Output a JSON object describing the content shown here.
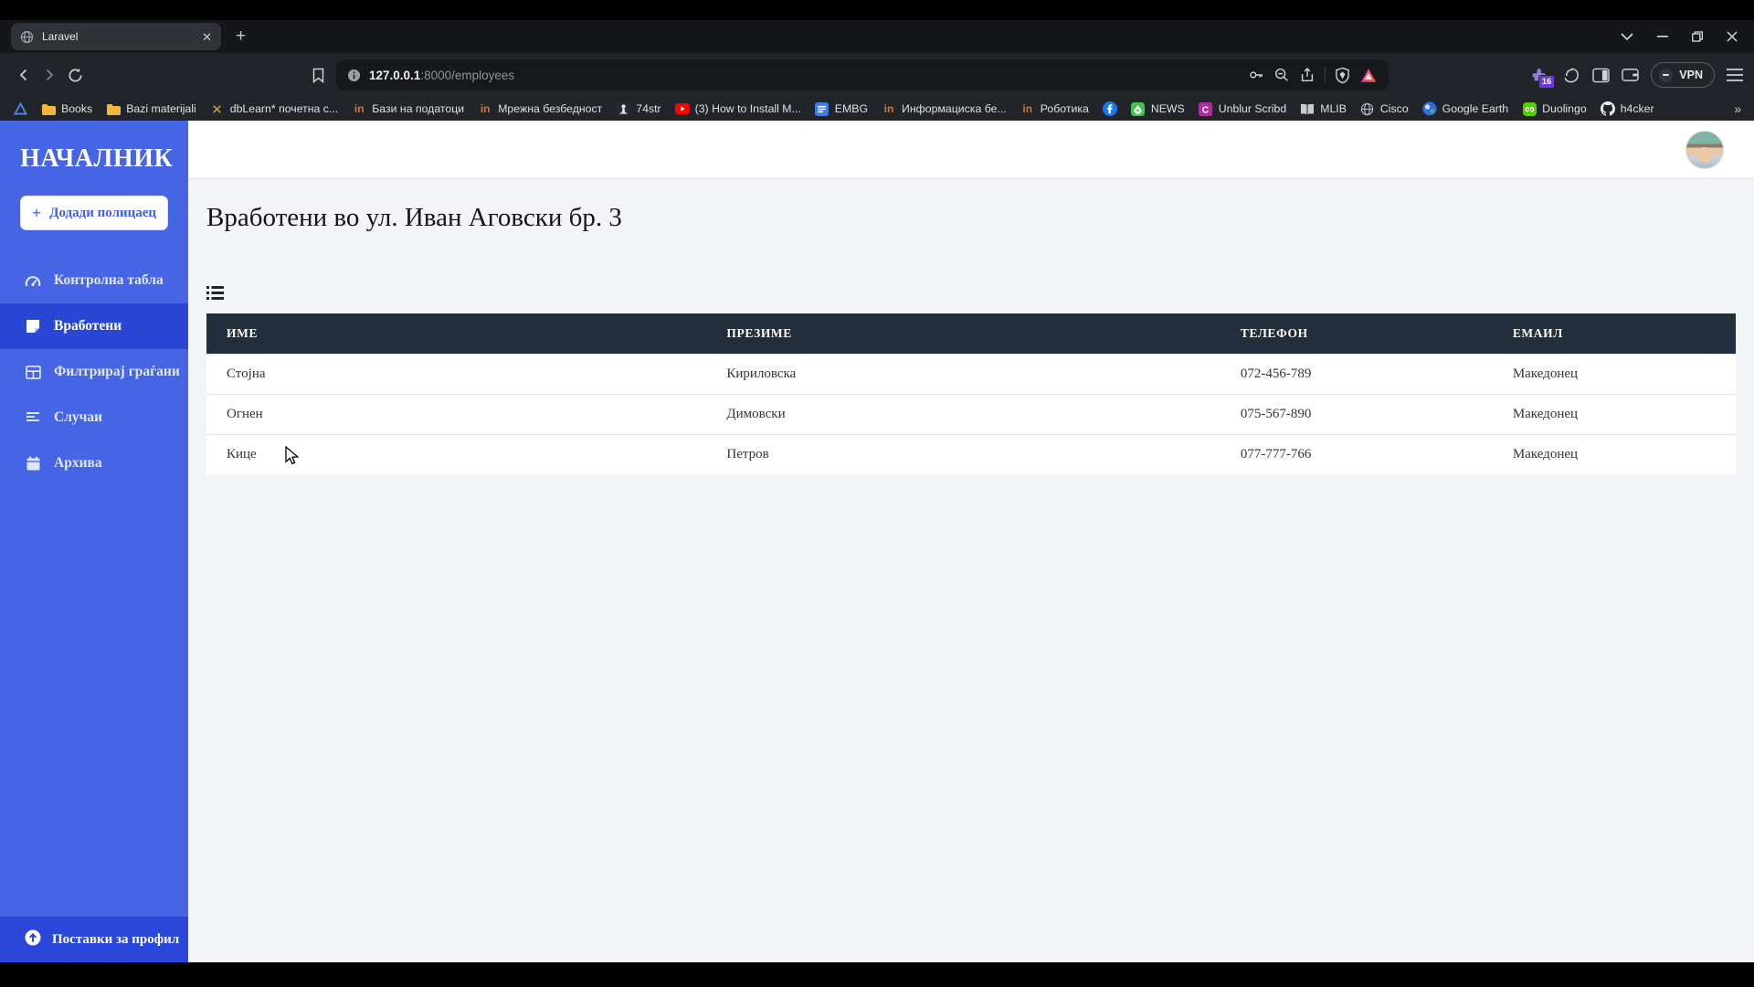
{
  "browser": {
    "tab_title": "Laravel",
    "new_tab_glyph": "+",
    "url": {
      "host": "127.0.0.1",
      "path": ":8000/employees"
    },
    "extension_badge": "16",
    "vpn_label": "VPN",
    "bookmarks_overflow": "»",
    "toolbar_icons": [
      "back-icon",
      "forward-icon",
      "reload-icon",
      "bookmark-flag-icon",
      "info-icon",
      "key-icon",
      "zoom-out-icon",
      "share-icon",
      "brave-shield-icon",
      "brave-rewards-icon",
      "extension-icon",
      "leo-ai-icon",
      "side-panel-icon",
      "wallet-icon",
      "vpn-button",
      "menu-icon"
    ],
    "bookmarks": [
      {
        "icon": "triangle-logo-icon",
        "label": ""
      },
      {
        "icon": "folder-icon",
        "label": "Books"
      },
      {
        "icon": "folder-icon",
        "label": "Bazi materijali"
      },
      {
        "icon": "dblearn-icon",
        "label": "dbLearn* почетна с..."
      },
      {
        "icon": "linkedin-icon",
        "label": "Бази на податоци"
      },
      {
        "icon": "linkedin-icon",
        "label": "Мрежна безбедност"
      },
      {
        "icon": "statue-icon",
        "label": "74str"
      },
      {
        "icon": "youtube-icon",
        "label": "(3) How to Install M..."
      },
      {
        "icon": "embg-icon",
        "label": "EMBG"
      },
      {
        "icon": "linkedin-icon",
        "label": "Информациска бе..."
      },
      {
        "icon": "linkedin-icon",
        "label": "Роботика"
      },
      {
        "icon": "facebook-icon",
        "label": ""
      },
      {
        "icon": "feedly-icon",
        "label": "NEWS"
      },
      {
        "icon": "scribd-icon",
        "label": "Unblur Scribd"
      },
      {
        "icon": "book-icon",
        "label": "MLIB"
      },
      {
        "icon": "globe-icon",
        "label": "Cisco"
      },
      {
        "icon": "earth-icon",
        "label": "Google Earth"
      },
      {
        "icon": "duolingo-icon",
        "label": "Duolingo"
      },
      {
        "icon": "github-icon",
        "label": "h4cker"
      }
    ]
  },
  "sidebar": {
    "title": "НАЧАЛНИК",
    "add_button_label": "Додади полицаец",
    "items": [
      {
        "icon": "gauge-icon",
        "label": "Контролна табла",
        "active": false
      },
      {
        "icon": "note-icon",
        "label": "Вработени",
        "active": true
      },
      {
        "icon": "table-icon",
        "label": "Филтрирај граѓани",
        "active": false
      },
      {
        "icon": "list-lines-icon",
        "label": "Случаи",
        "active": false
      },
      {
        "icon": "calendar-icon",
        "label": "Архива",
        "active": false
      }
    ],
    "footer_label": "Поставки за профил"
  },
  "main": {
    "heading": "Вработени во ул. Иван Аговски бр. 3",
    "table": {
      "columns": [
        "ИМЕ",
        "ПРЕЗИМЕ",
        "ТЕЛЕФОН",
        "ЕМАИЛ"
      ],
      "rows": [
        [
          "Стојна",
          "Кириловска",
          "072-456-789",
          "Македонец"
        ],
        [
          "Огнен",
          "Димовски",
          "075-567-890",
          "Македонец"
        ],
        [
          "Кице",
          "Петров",
          "077-777-766",
          "Македонец"
        ]
      ]
    }
  },
  "colors": {
    "sidebar_blue": "#4565e4",
    "sidebar_active_blue": "#2a46d4",
    "sidebar_footer_blue": "#2b47da",
    "table_header_dark": "#232e3c",
    "content_background": "#f4f5f8",
    "chrome_dark": "#212428",
    "brand_blue_text": "#4060e2"
  }
}
